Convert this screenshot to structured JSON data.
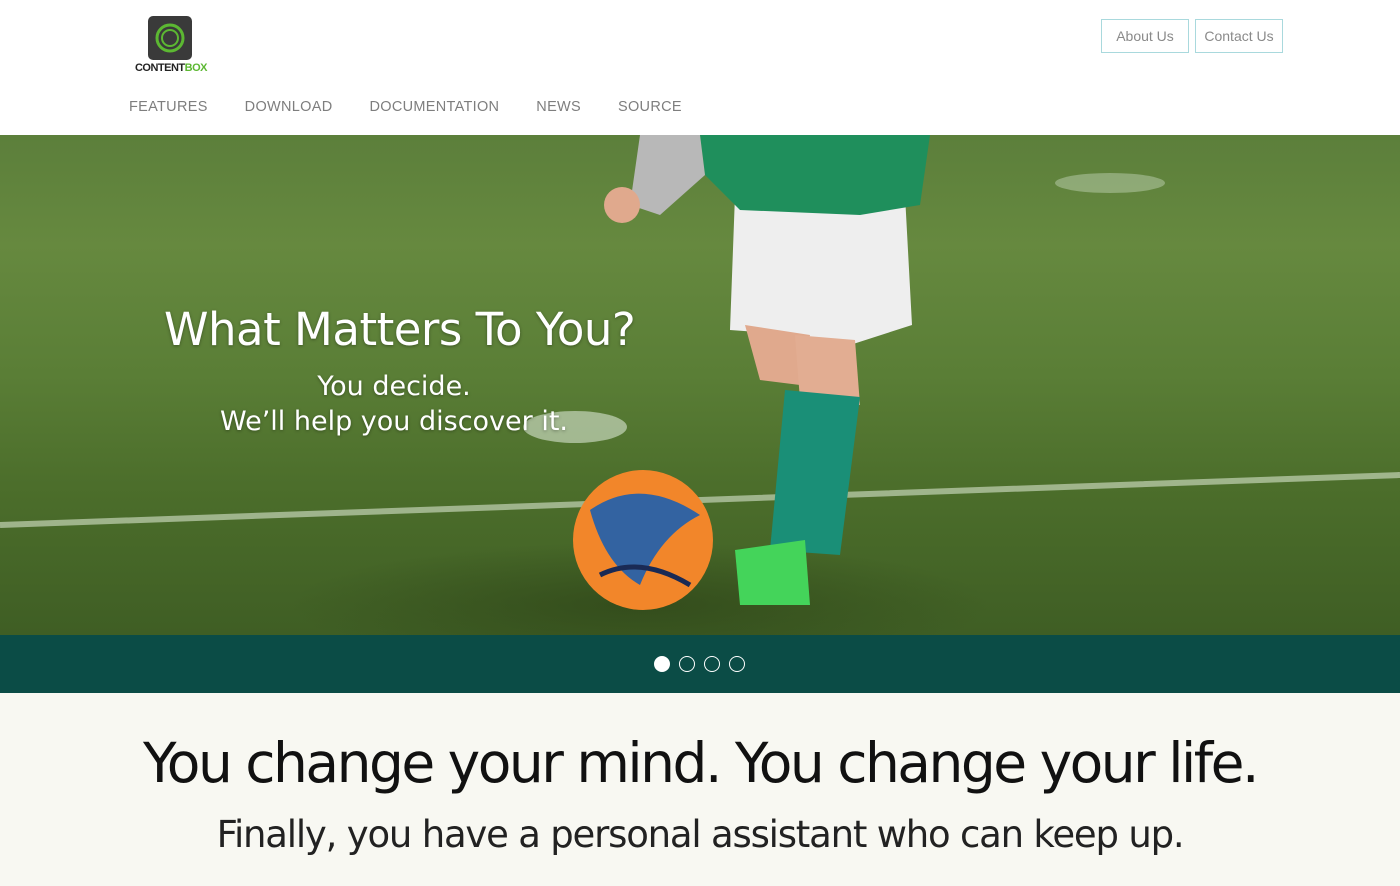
{
  "header": {
    "logo": {
      "word_part1": "CONTENT",
      "word_part2": "BOX"
    },
    "buttons": {
      "about": "About Us",
      "contact": "Contact Us"
    },
    "nav": [
      {
        "label": "FEATURES"
      },
      {
        "label": "DOWNLOAD"
      },
      {
        "label": "DOCUMENTATION"
      },
      {
        "label": "NEWS"
      },
      {
        "label": "SOURCE"
      }
    ]
  },
  "hero": {
    "title": "What Matters To You?",
    "line1": "You decide.",
    "line2": "We’ll help you discover it.",
    "background": "photo: child kicking soccer ball on green turf"
  },
  "carousel": {
    "slide_count": 4,
    "active_index": 0
  },
  "tagline": {
    "main": "You change your mind.  You change your life.",
    "sub": "Finally,  you have a personal assistant who can keep up."
  },
  "colors": {
    "brand_green": "#5cb832",
    "carousel_bar": "#0b4c46",
    "button_border": "#a9d9dd",
    "nav_text": "#7e7e7e",
    "tagline_bg": "#f8f8f2"
  }
}
